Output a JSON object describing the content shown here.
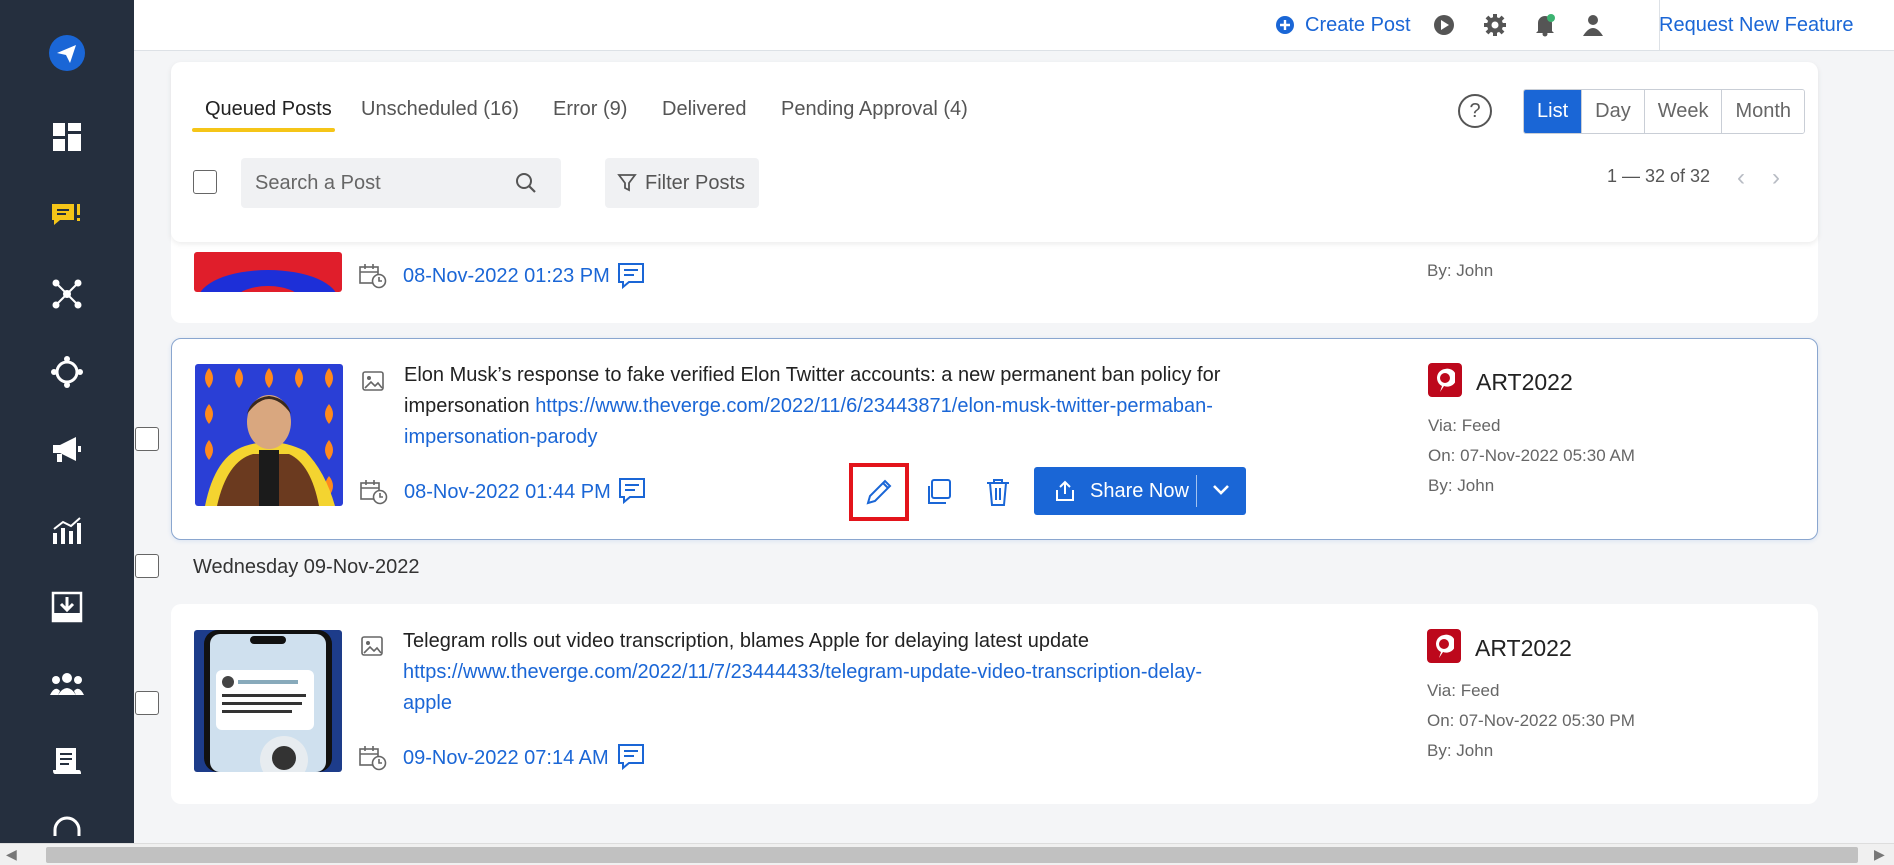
{
  "app": {
    "accent": "#1a66d6",
    "sidebar_bg": "#252f3e",
    "highlight_color": "#e3141b"
  },
  "sidebar": {
    "items": [
      {
        "name": "paper-plane-icon",
        "active": false
      },
      {
        "name": "dashboard-icon",
        "active": false
      },
      {
        "name": "chat-alert-icon",
        "active": true
      },
      {
        "name": "network-icon",
        "active": false
      },
      {
        "name": "target-icon",
        "active": false
      },
      {
        "name": "megaphone-icon",
        "active": false
      },
      {
        "name": "analytics-icon",
        "active": false
      },
      {
        "name": "download-tray-icon",
        "active": false
      },
      {
        "name": "team-icon",
        "active": false
      },
      {
        "name": "report-icon",
        "active": false
      },
      {
        "name": "headset-icon",
        "active": false
      }
    ]
  },
  "topbar": {
    "create_post": "Create Post",
    "request_feature": "Request New Feature"
  },
  "tabs": [
    {
      "label": "Queued Posts",
      "active": true
    },
    {
      "label": "Unscheduled (16)",
      "active": false
    },
    {
      "label": "Error (9)",
      "active": false
    },
    {
      "label": "Delivered",
      "active": false
    },
    {
      "label": "Pending Approval (4)",
      "active": false
    }
  ],
  "help_label": "?",
  "views": [
    "List",
    "Day",
    "Week",
    "Month"
  ],
  "active_view": "List",
  "search": {
    "placeholder": "Search a Post",
    "value": ""
  },
  "filter_label": "Filter Posts",
  "pagination": {
    "range": "1 — 32 of 32"
  },
  "posts": [
    {
      "date": "08-Nov-2022 01:23 PM",
      "by": "By: John"
    },
    {
      "text": "Elon Musk’s response to fake verified Elon Twitter accounts: a new permanent ban policy for impersonation",
      "link": "https://www.theverge.com/2022/11/6/23443871/elon-musk-twitter-permaban-impersonation-parody",
      "date": "08-Nov-2022 01:44 PM",
      "account": "ART2022",
      "via": "Via: Feed",
      "on": "On: 07-Nov-2022 05:30 AM",
      "by": "By: John",
      "share_label": "Share Now"
    },
    {
      "text": "Telegram rolls out video transcription, blames Apple for delaying latest update",
      "link": "https://www.theverge.com/2022/11/7/23444433/telegram-update-video-transcription-delay-apple",
      "date": "09-Nov-2022 07:14 AM",
      "account": "ART2022",
      "via": "Via: Feed",
      "on": "On: 07-Nov-2022 05:30 PM",
      "by": "By: John"
    }
  ],
  "day_heading": "Wednesday 09-Nov-2022"
}
